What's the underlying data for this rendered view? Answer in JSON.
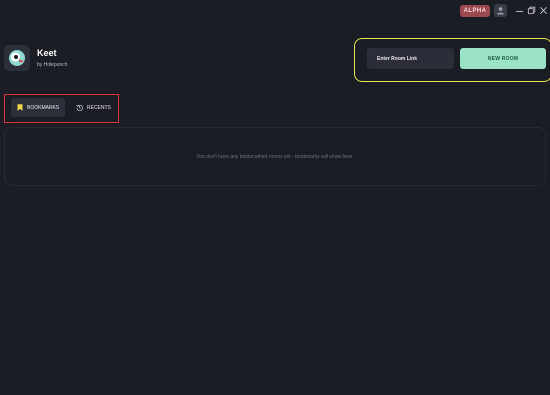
{
  "window": {
    "badge": "ALPHA",
    "controls": [
      "minimize-icon",
      "restore-icon",
      "close-icon"
    ]
  },
  "app": {
    "name": "Keet",
    "byline": "by Holepunch"
  },
  "room": {
    "link_placeholder": "Enter Room Link",
    "new_room_label": "NEW ROOM"
  },
  "tabs": [
    {
      "label": "BOOKMARKS",
      "icon": "bookmark-icon",
      "active": true
    },
    {
      "label": "RECENTS",
      "icon": "history-icon",
      "active": false
    }
  ],
  "bookmarks": {
    "empty_message": "You don't have any bookmarked rooms yet - bookmarks will show here."
  },
  "colors": {
    "background": "#1b1d24",
    "accent": "#9ae3c6",
    "badge": "#9a4a4f",
    "highlight_yellow": "#e9e44a",
    "highlight_red": "#d8343a"
  }
}
